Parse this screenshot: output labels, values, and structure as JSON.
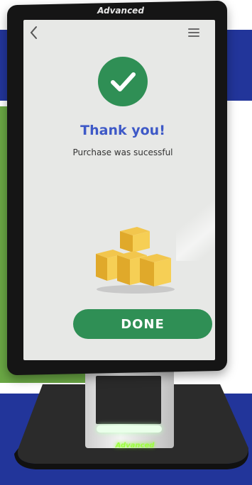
{
  "brand": "Advanced",
  "screen": {
    "title": "Thank you!",
    "subtitle": "Purchase was sucessful",
    "done_label": "DONE",
    "icons": {
      "back": "chevron-left-icon",
      "menu": "hamburger-menu-icon",
      "success": "check-icon",
      "illustration": "boxes-icon"
    }
  },
  "base_logo": "Advanced",
  "colors": {
    "primary_green": "#2f8f55",
    "title_blue": "#3e59c7",
    "banner_blue": "#22359a",
    "banner_green": "#6aa744"
  }
}
